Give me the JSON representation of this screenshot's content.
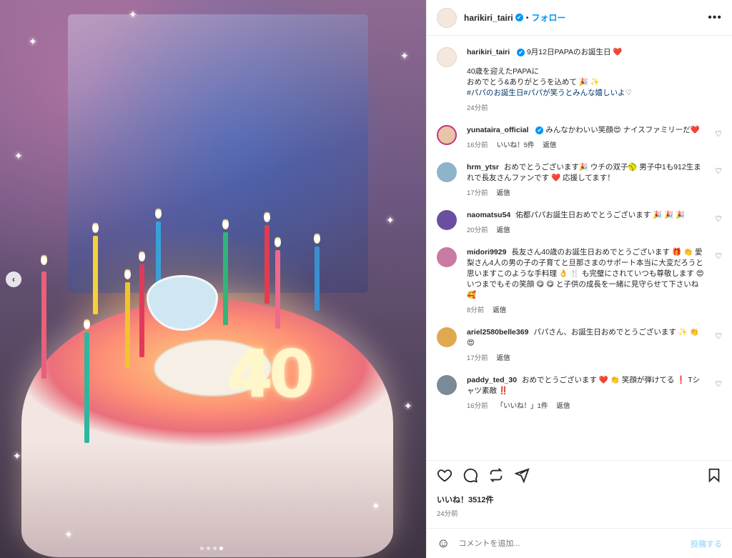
{
  "post": {
    "author": "harikiri_tairi",
    "follow_label": "フォロー",
    "more_label": "•••",
    "verified_mark": "✔",
    "separator": "•"
  },
  "caption": {
    "user": "harikiri_tairi",
    "line1": "9月12日PAPAのお誕生日 ❤️",
    "line2": "40歳を迎えたPAPAに",
    "line3": "おめでとう&ありがとうを込めて 🎉 ✨",
    "hashtags": "#パパのお誕生日#パパが笑うとみんな嬉しいよ♡",
    "time": "24分前"
  },
  "comments": [
    {
      "user": "yunataira_official",
      "verified": true,
      "text": "みんなかわいい笑顔😍 ナイスファミリーだ❤️",
      "time": "16分前",
      "likes": "いいね！5件",
      "reply": "返信",
      "avatar_color": "#e8c4a8"
    },
    {
      "user": "hrm_ytsr",
      "verified": false,
      "text": "おめでとうございます🎉 ウチの双子🥎 男子中1も912生まれで長友さんファンです ❤️ 応援してます！",
      "time": "17分前",
      "likes": "",
      "reply": "返信",
      "avatar_color": "#8fb3c9"
    },
    {
      "user": "naomatsu54",
      "verified": false,
      "text": "佑都パパお誕生日おめでとうございます 🎉 🎉 🎉",
      "time": "20分前",
      "likes": "",
      "reply": "返信",
      "avatar_color": "#6a4fa0"
    },
    {
      "user": "midori9929",
      "verified": false,
      "text": "長友さん40歳のお誕生日おめでとうございます 🎁 👏 愛梨さん4人の男の子の子育てと旦那さまのサポート本当に大変だろうと思いますこのような手料理 👌 🍴 も完璧にされていつも尊敬します 😍 いつまでもその笑顔 😋 😋 と子供の成長を一緒に見守らせて下さいね 🥰",
      "time": "8分前",
      "likes": "",
      "reply": "返信",
      "avatar_color": "#c97aa0"
    },
    {
      "user": "ariel2580belle369",
      "verified": false,
      "text": "パパさん、お誕生日おめでとうございます ✨ 👏 😍",
      "time": "17分前",
      "likes": "",
      "reply": "返信",
      "avatar_color": "#e0a950"
    },
    {
      "user": "paddy_ted_30",
      "verified": false,
      "text": "おめでとうございます ❤️ 👏 笑顔が弾けてる ❗ Tシャツ素敵 ‼️",
      "time": "16分前",
      "likes": "「いいね！」1件",
      "reply": "返信",
      "avatar_color": "#7a8a96"
    }
  ],
  "actions": {
    "like_icon": "heart-icon",
    "comment_icon": "comment-icon",
    "share_icon": "repost-icon",
    "send_icon": "send-icon",
    "save_icon": "bookmark-icon",
    "like_count": "いいね！3512件",
    "time": "24分前"
  },
  "add_comment": {
    "placeholder": "コメントを追加...",
    "post_label": "投稿する"
  },
  "media": {
    "cake_number": "40",
    "carousel_total": 4,
    "carousel_active": 4
  }
}
